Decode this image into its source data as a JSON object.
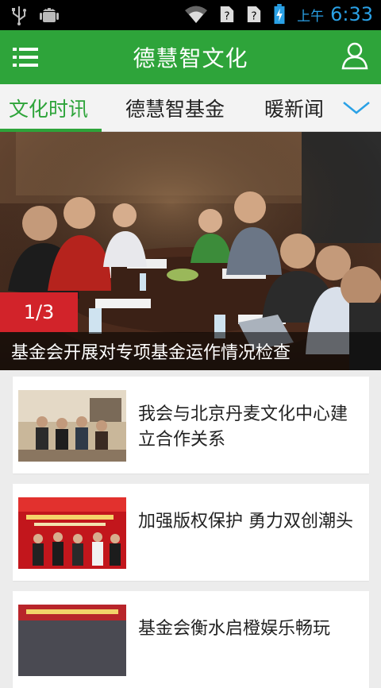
{
  "status_bar": {
    "ampm": "上午",
    "time": "6:33",
    "icons": [
      "usb-icon",
      "android-icon",
      "wifi-icon",
      "sim-unknown-icon",
      "sim-unknown-icon",
      "battery-charging-icon"
    ]
  },
  "app_bar": {
    "title": "德慧智文化",
    "menu_icon": "menu-list-icon",
    "user_icon": "user-icon"
  },
  "tabs": {
    "items": [
      {
        "label": "文化时讯",
        "active": true
      },
      {
        "label": "德慧智基金",
        "active": false
      },
      {
        "label": "暖新闻",
        "active": false
      }
    ],
    "more_icon": "chevron-down-icon"
  },
  "banner": {
    "counter": "1/3",
    "caption": "基金会开展对专项基金运作情况检查"
  },
  "news": [
    {
      "title": "我会与北京丹麦文化中心建立合作关系"
    },
    {
      "title": "加强版权保护 勇力双创潮头"
    },
    {
      "title": "基金会衡水启橙娱乐畅玩"
    }
  ],
  "colors": {
    "brand_green": "#2ea43a",
    "badge_red": "#d2232a",
    "status_blue": "#2aa1e6"
  }
}
